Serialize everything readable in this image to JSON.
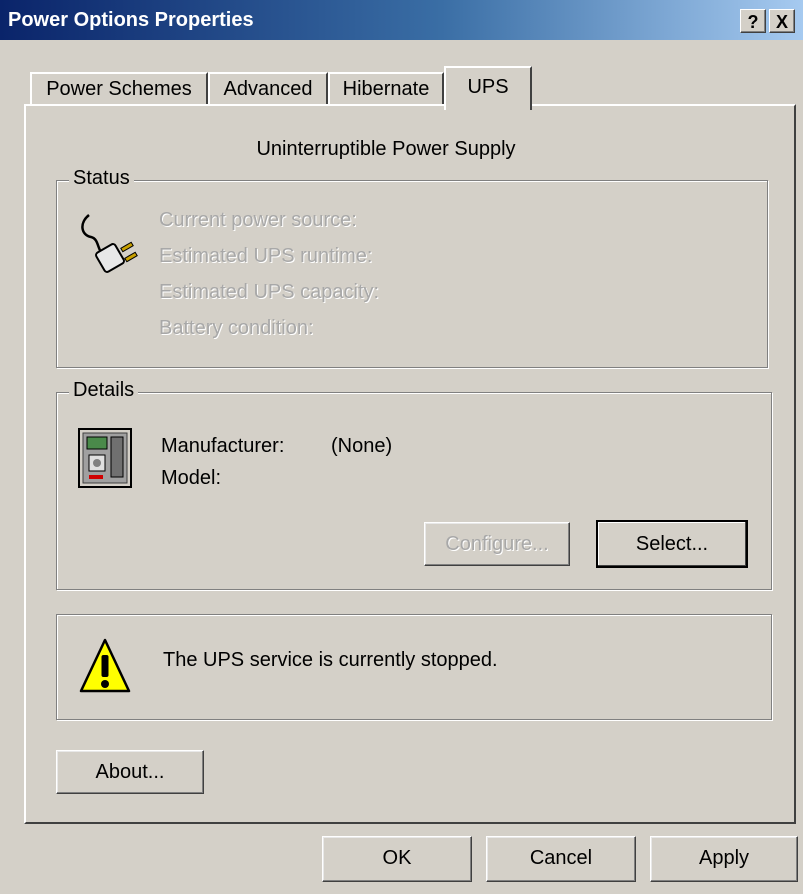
{
  "window": {
    "title": "Power Options Properties",
    "help_label": "?",
    "close_label": "X"
  },
  "tabs": [
    {
      "label": "Power Schemes"
    },
    {
      "label": "Advanced"
    },
    {
      "label": "Hibernate"
    },
    {
      "label": "UPS",
      "active": true
    }
  ],
  "ups": {
    "heading": "Uninterruptible Power Supply",
    "status": {
      "legend": "Status",
      "lines": [
        "Current power source:",
        "Estimated UPS runtime:",
        "Estimated UPS capacity:",
        "Battery condition:"
      ]
    },
    "details": {
      "legend": "Details",
      "manufacturer_label": "Manufacturer:",
      "manufacturer_value": "(None)",
      "model_label": "Model:",
      "configure_label": "Configure...",
      "select_label": "Select..."
    },
    "warning": "The UPS service is currently stopped.",
    "about_label": "About..."
  },
  "footer": {
    "ok_label": "OK",
    "cancel_label": "Cancel",
    "apply_label": "Apply"
  },
  "icons": [
    "plug-icon",
    "ups-device-icon",
    "warning-icon"
  ]
}
